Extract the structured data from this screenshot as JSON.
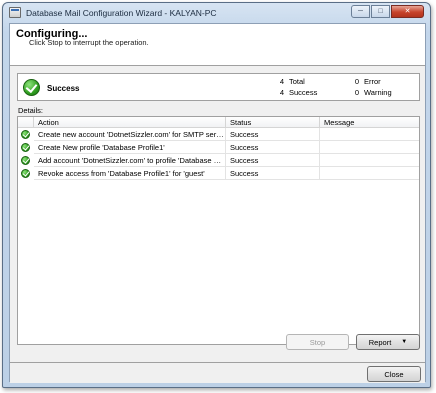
{
  "window": {
    "title": "Database Mail Configuration Wizard - KALYAN-PC",
    "controls": [
      "minimize",
      "maximize",
      "close"
    ]
  },
  "header": {
    "title": "Configuring...",
    "subtitle": "Click Stop to interrupt the operation."
  },
  "summary": {
    "status": "Success",
    "total_count": "4",
    "total_label": "Total",
    "success_count": "4",
    "success_label": "Success",
    "error_count": "0",
    "error_label": "Error",
    "warning_count": "0",
    "warning_label": "Warning"
  },
  "details": {
    "label": "Details:",
    "columns": [
      "Action",
      "Status",
      "Message"
    ],
    "rows": [
      {
        "icon": "success-check-icon",
        "action": "Create new account 'DotnetSizzler.com' for SMTP server ...",
        "status": "Success",
        "message": ""
      },
      {
        "icon": "success-check-icon",
        "action": "Create New profile 'Database Profile1'",
        "status": "Success",
        "message": ""
      },
      {
        "icon": "success-check-icon",
        "action": "Add account 'DotnetSizzler.com' to profile 'Database Profi...",
        "status": "Success",
        "message": ""
      },
      {
        "icon": "success-check-icon",
        "action": "Revoke access from 'Database Profile1' for 'guest'",
        "status": "Success",
        "message": ""
      }
    ]
  },
  "buttons": {
    "stop": "Stop",
    "report": "Report",
    "close": "Close"
  },
  "colors": {
    "success_green": "#2f9e1f",
    "title_gradient": "#c3d6eb",
    "close_red": "#c7432b"
  }
}
